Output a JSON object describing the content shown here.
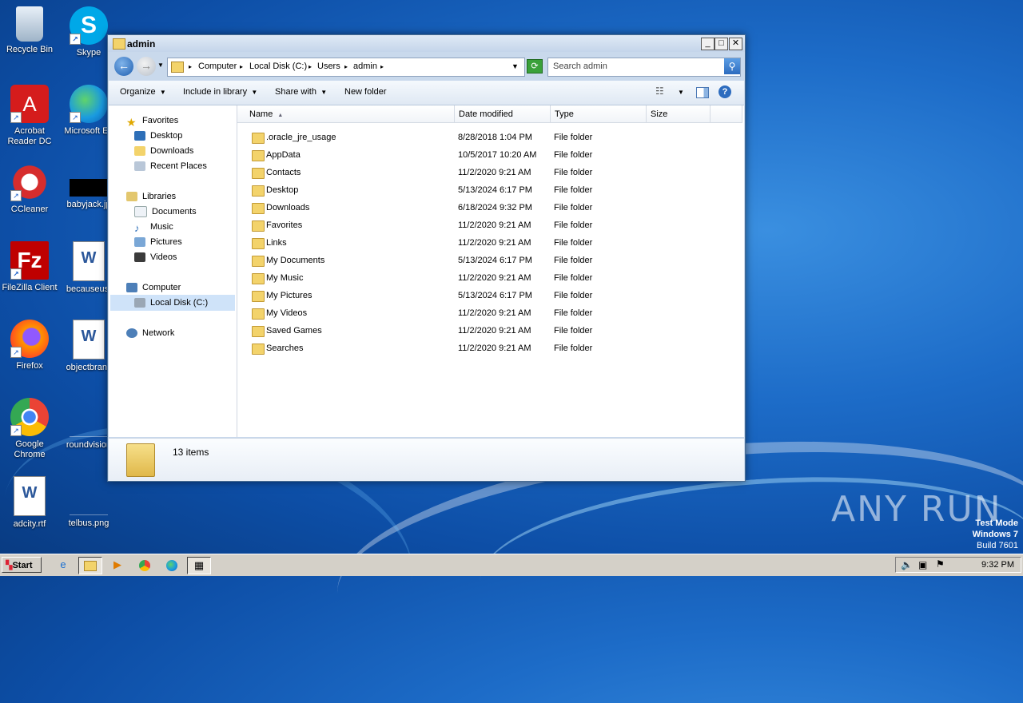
{
  "desktop": {
    "icons": [
      {
        "label": "Recycle Bin"
      },
      {
        "label": "Skype"
      },
      {
        "label": "Acrobat Reader DC"
      },
      {
        "label": "Microsoft Ed"
      },
      {
        "label": "CCleaner"
      },
      {
        "label": "babyjack.jp"
      },
      {
        "label": "FileZilla Client"
      },
      {
        "label": "becauseus."
      },
      {
        "label": "Firefox"
      },
      {
        "label": "objectbranc"
      },
      {
        "label": "Google Chrome"
      },
      {
        "label": "roundvision"
      },
      {
        "label": "adcity.rtf"
      },
      {
        "label": "telbus.png"
      }
    ]
  },
  "window": {
    "title": "admin",
    "address": [
      "Computer",
      "Local Disk (C:)",
      "Users",
      "admin"
    ],
    "search_placeholder": "Search admin",
    "toolbar": {
      "organize": "Organize",
      "include_in_library": "Include in library",
      "share_with": "Share with",
      "new_folder": "New folder"
    },
    "nav": {
      "favorites": "Favorites",
      "desktop": "Desktop",
      "downloads": "Downloads",
      "recent_places": "Recent Places",
      "libraries": "Libraries",
      "documents": "Documents",
      "music": "Music",
      "pictures": "Pictures",
      "videos": "Videos",
      "computer": "Computer",
      "local_disk": "Local Disk (C:)",
      "network": "Network"
    },
    "columns": {
      "name": "Name",
      "date": "Date modified",
      "type": "Type",
      "size": "Size"
    },
    "rows": [
      {
        "name": ".oracle_jre_usage",
        "date": "8/28/2018 1:04 PM",
        "type": "File folder"
      },
      {
        "name": "AppData",
        "date": "10/5/2017 10:20 AM",
        "type": "File folder"
      },
      {
        "name": "Contacts",
        "date": "11/2/2020 9:21 AM",
        "type": "File folder"
      },
      {
        "name": "Desktop",
        "date": "5/13/2024 6:17 PM",
        "type": "File folder"
      },
      {
        "name": "Downloads",
        "date": "6/18/2024 9:32 PM",
        "type": "File folder"
      },
      {
        "name": "Favorites",
        "date": "11/2/2020 9:21 AM",
        "type": "File folder"
      },
      {
        "name": "Links",
        "date": "11/2/2020 9:21 AM",
        "type": "File folder"
      },
      {
        "name": "My Documents",
        "date": "5/13/2024 6:17 PM",
        "type": "File folder"
      },
      {
        "name": "My Music",
        "date": "11/2/2020 9:21 AM",
        "type": "File folder"
      },
      {
        "name": "My Pictures",
        "date": "5/13/2024 6:17 PM",
        "type": "File folder"
      },
      {
        "name": "My Videos",
        "date": "11/2/2020 9:21 AM",
        "type": "File folder"
      },
      {
        "name": "Saved Games",
        "date": "11/2/2020 9:21 AM",
        "type": "File folder"
      },
      {
        "name": "Searches",
        "date": "11/2/2020 9:21 AM",
        "type": "File folder"
      }
    ],
    "status": "13 items"
  },
  "watermark": "ANY RUN",
  "testmode": {
    "line1": "Test Mode",
    "line2": "Windows 7",
    "line3": "Build 7601"
  },
  "taskbar": {
    "start": "Start",
    "clock": "9:32 PM"
  }
}
